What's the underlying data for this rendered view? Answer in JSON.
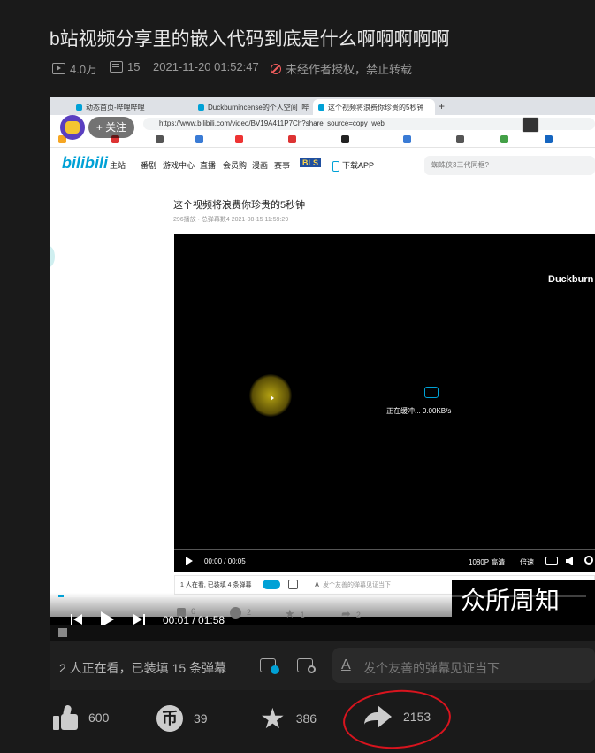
{
  "page": {
    "title": "b站视频分享里的嵌入代码到底是什么啊啊啊啊啊",
    "views": "4.0万",
    "danmaku_count": "15",
    "datetime": "2021-11-20 01:52:47",
    "copyright_notice": "未经作者授权，禁止转载"
  },
  "embedded": {
    "tabs": [
      "动态首页-哔哩哔哩",
      "Duckburnincense的个人空间_哔",
      "这个视频将浪费你珍贵的5秒钟_"
    ],
    "url": "https://www.bilibili.com/video/BV19A411P7Ch?share_source=copy_web",
    "follow_label": "关注",
    "nav": [
      "主站",
      "番剧",
      "游戏中心",
      "直播",
      "会员购",
      "漫画",
      "赛事",
      "BLS",
      "下载APP"
    ],
    "search_placeholder": "蜘蛛侠3三代同框?",
    "video_title": "这个视频将浪费你珍贵的5秒钟",
    "video_meta": "296播放 · 总弹幕数4   2021-08-15 11:59:29",
    "watermark": "Duckburn",
    "buffer_text": "正在缓冲... 0.00KB/s",
    "inner_time": "00:00 / 00:05",
    "inner_quality": "1080P 高清",
    "inner_speed": "倍速",
    "inner_danmu_status": "1 人在看, 已装填 4 条弹幕",
    "inner_danmu_placeholder": "发个友善的弹幕见证当下",
    "inner_actions": [
      "6",
      "2",
      "1",
      "2"
    ],
    "subtitle": "众所周知"
  },
  "player": {
    "current_time": "00:01",
    "duration": "01:58",
    "progress": 0.01
  },
  "danmaku_bar": {
    "status": "2 人正在看，已装填 15 条弹幕",
    "placeholder": "发个友善的弹幕见证当下"
  },
  "actions": {
    "like": "600",
    "coin": "39",
    "favorite": "386",
    "share": "2153"
  },
  "colors": {
    "background": "#1a1a1a",
    "bilibili_blue": "#00a1d6",
    "annotation_red": "#d8141e"
  }
}
